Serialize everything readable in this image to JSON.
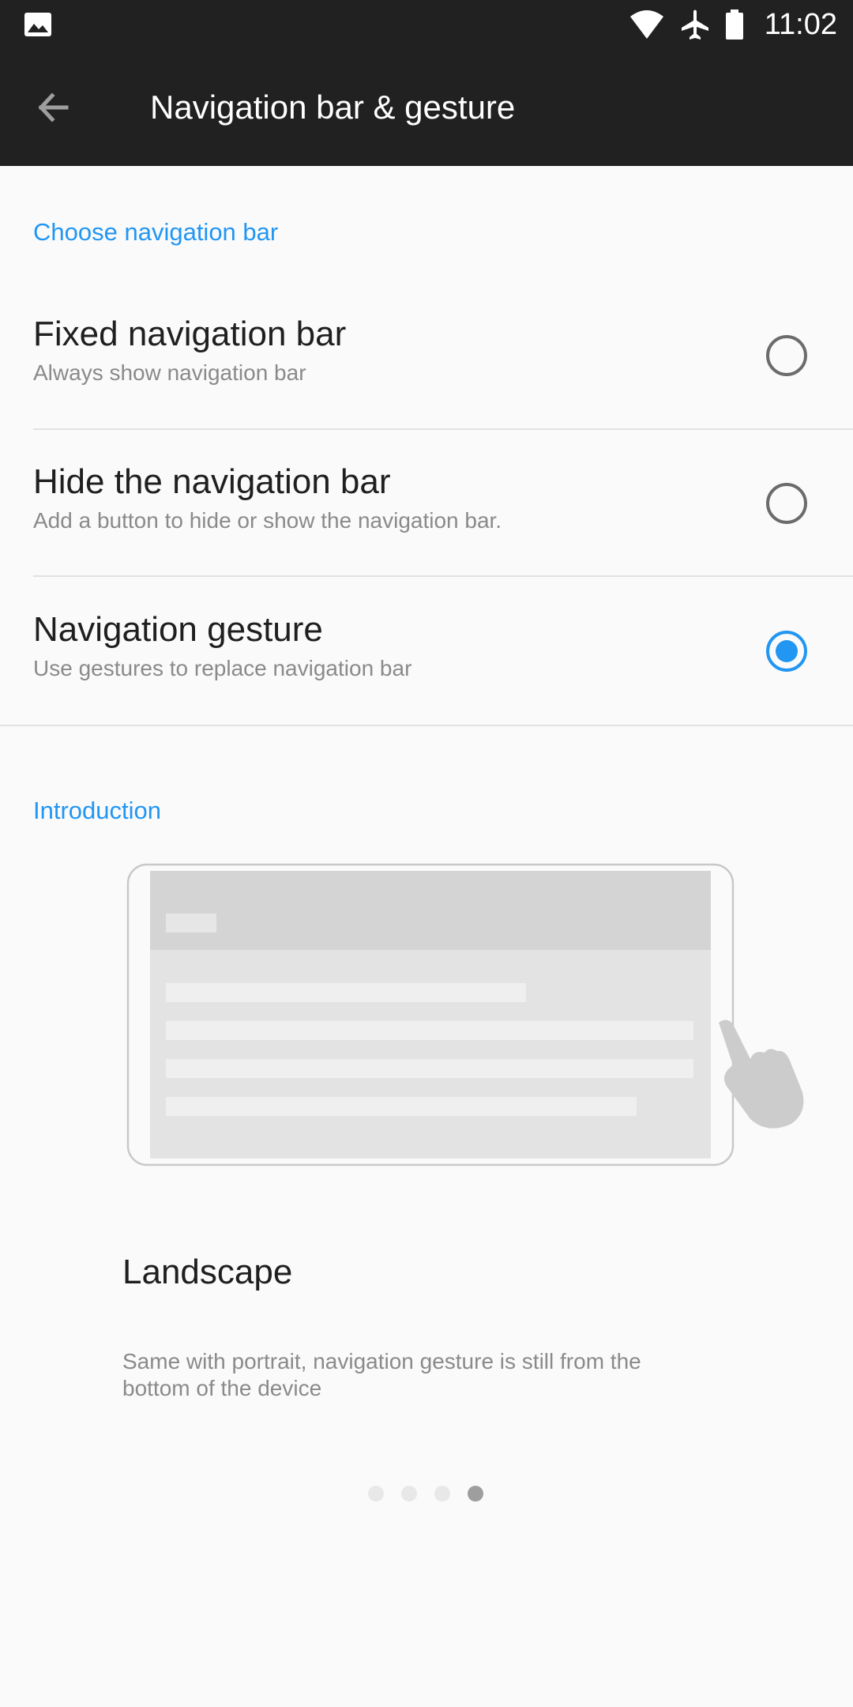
{
  "status_bar": {
    "time": "11:02",
    "icons": [
      "gallery-icon",
      "wifi-icon",
      "airplane-mode-icon",
      "battery-icon"
    ]
  },
  "app_bar": {
    "title": "Navigation bar & gesture",
    "back_icon": "arrow-left-icon"
  },
  "choose_section": {
    "header": "Choose navigation bar",
    "options": [
      {
        "title": "Fixed navigation bar",
        "subtitle": "Always show navigation bar",
        "selected": false
      },
      {
        "title": "Hide the navigation bar",
        "subtitle": "Add a button to hide or show the navigation bar.",
        "selected": false
      },
      {
        "title": "Navigation gesture",
        "subtitle": "Use gestures to replace navigation bar",
        "selected": true
      }
    ]
  },
  "introduction": {
    "header": "Introduction",
    "slide_title": "Landscape",
    "slide_description": "Same with portrait, navigation gesture is still from the bottom of the device",
    "pager": {
      "total": 4,
      "current": 4
    }
  },
  "colors": {
    "accent": "#2196f3",
    "toolbar": "#212121",
    "background": "#fafafa"
  }
}
